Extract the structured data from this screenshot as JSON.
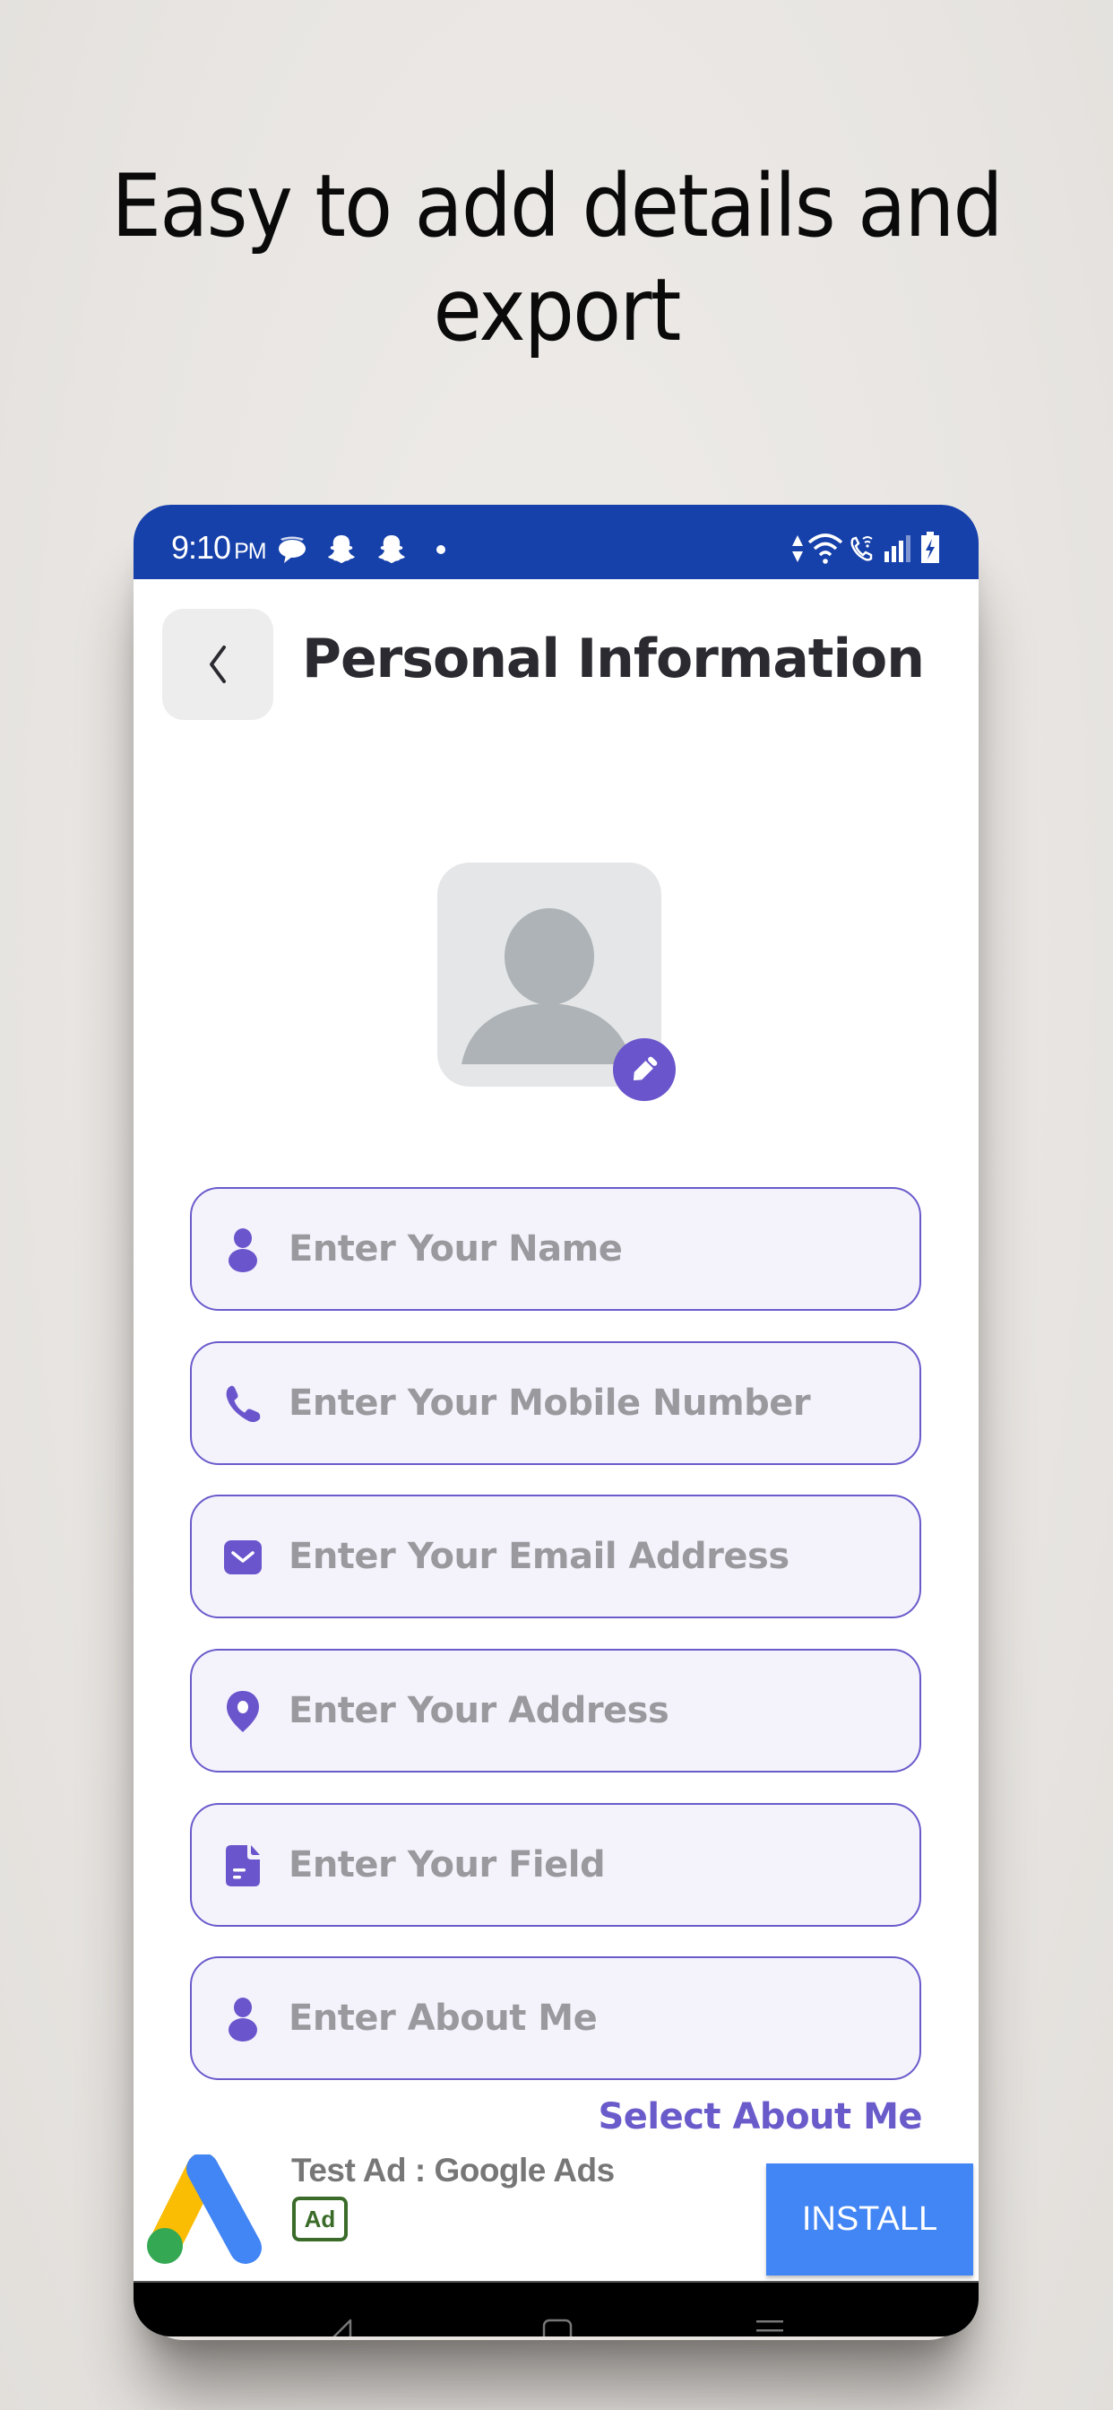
{
  "promo": {
    "headline_line1": "Easy to add details and",
    "headline_line2": "export"
  },
  "status_bar": {
    "time": "9:10",
    "ampm": "PM",
    "left_icons": [
      "messages-icon",
      "snapchat-icon",
      "snapchat-icon",
      "dot-icon"
    ],
    "right_icons": [
      "data-arrows-icon",
      "wifi-icon",
      "wifi-calling-icon",
      "signal-icon",
      "battery-charging-icon"
    ],
    "background_color": "#1640AA"
  },
  "header": {
    "back_icon": "chevron-left-icon",
    "title": "Personal Information"
  },
  "avatar": {
    "placeholder_icon": "user-silhouette-icon",
    "edit_icon": "pencil-icon"
  },
  "form": {
    "fields": [
      {
        "name": "name",
        "icon": "person-icon",
        "placeholder": "Enter Your Name",
        "value": ""
      },
      {
        "name": "mobile",
        "icon": "phone-icon",
        "placeholder": "Enter Your Mobile Number",
        "value": ""
      },
      {
        "name": "email",
        "icon": "mail-icon",
        "placeholder": "Enter Your Email Address",
        "value": ""
      },
      {
        "name": "address",
        "icon": "location-pin-icon",
        "placeholder": "Enter Your Address",
        "value": ""
      },
      {
        "name": "field",
        "icon": "document-icon",
        "placeholder": "Enter Your Field",
        "value": ""
      },
      {
        "name": "about",
        "icon": "person-icon",
        "placeholder": "Enter About Me",
        "value": ""
      }
    ],
    "select_about_label": "Select About Me",
    "accent_color": "#6A5BCB"
  },
  "ad": {
    "logo_icon": "google-ads-logo-icon",
    "title": "Test Ad : Google Ads",
    "badge": "Ad",
    "install_label": "INSTALL",
    "install_color": "#4285F4"
  },
  "nav_bar": {
    "buttons": [
      "back-nav-icon",
      "home-nav-icon",
      "recents-nav-icon"
    ]
  }
}
